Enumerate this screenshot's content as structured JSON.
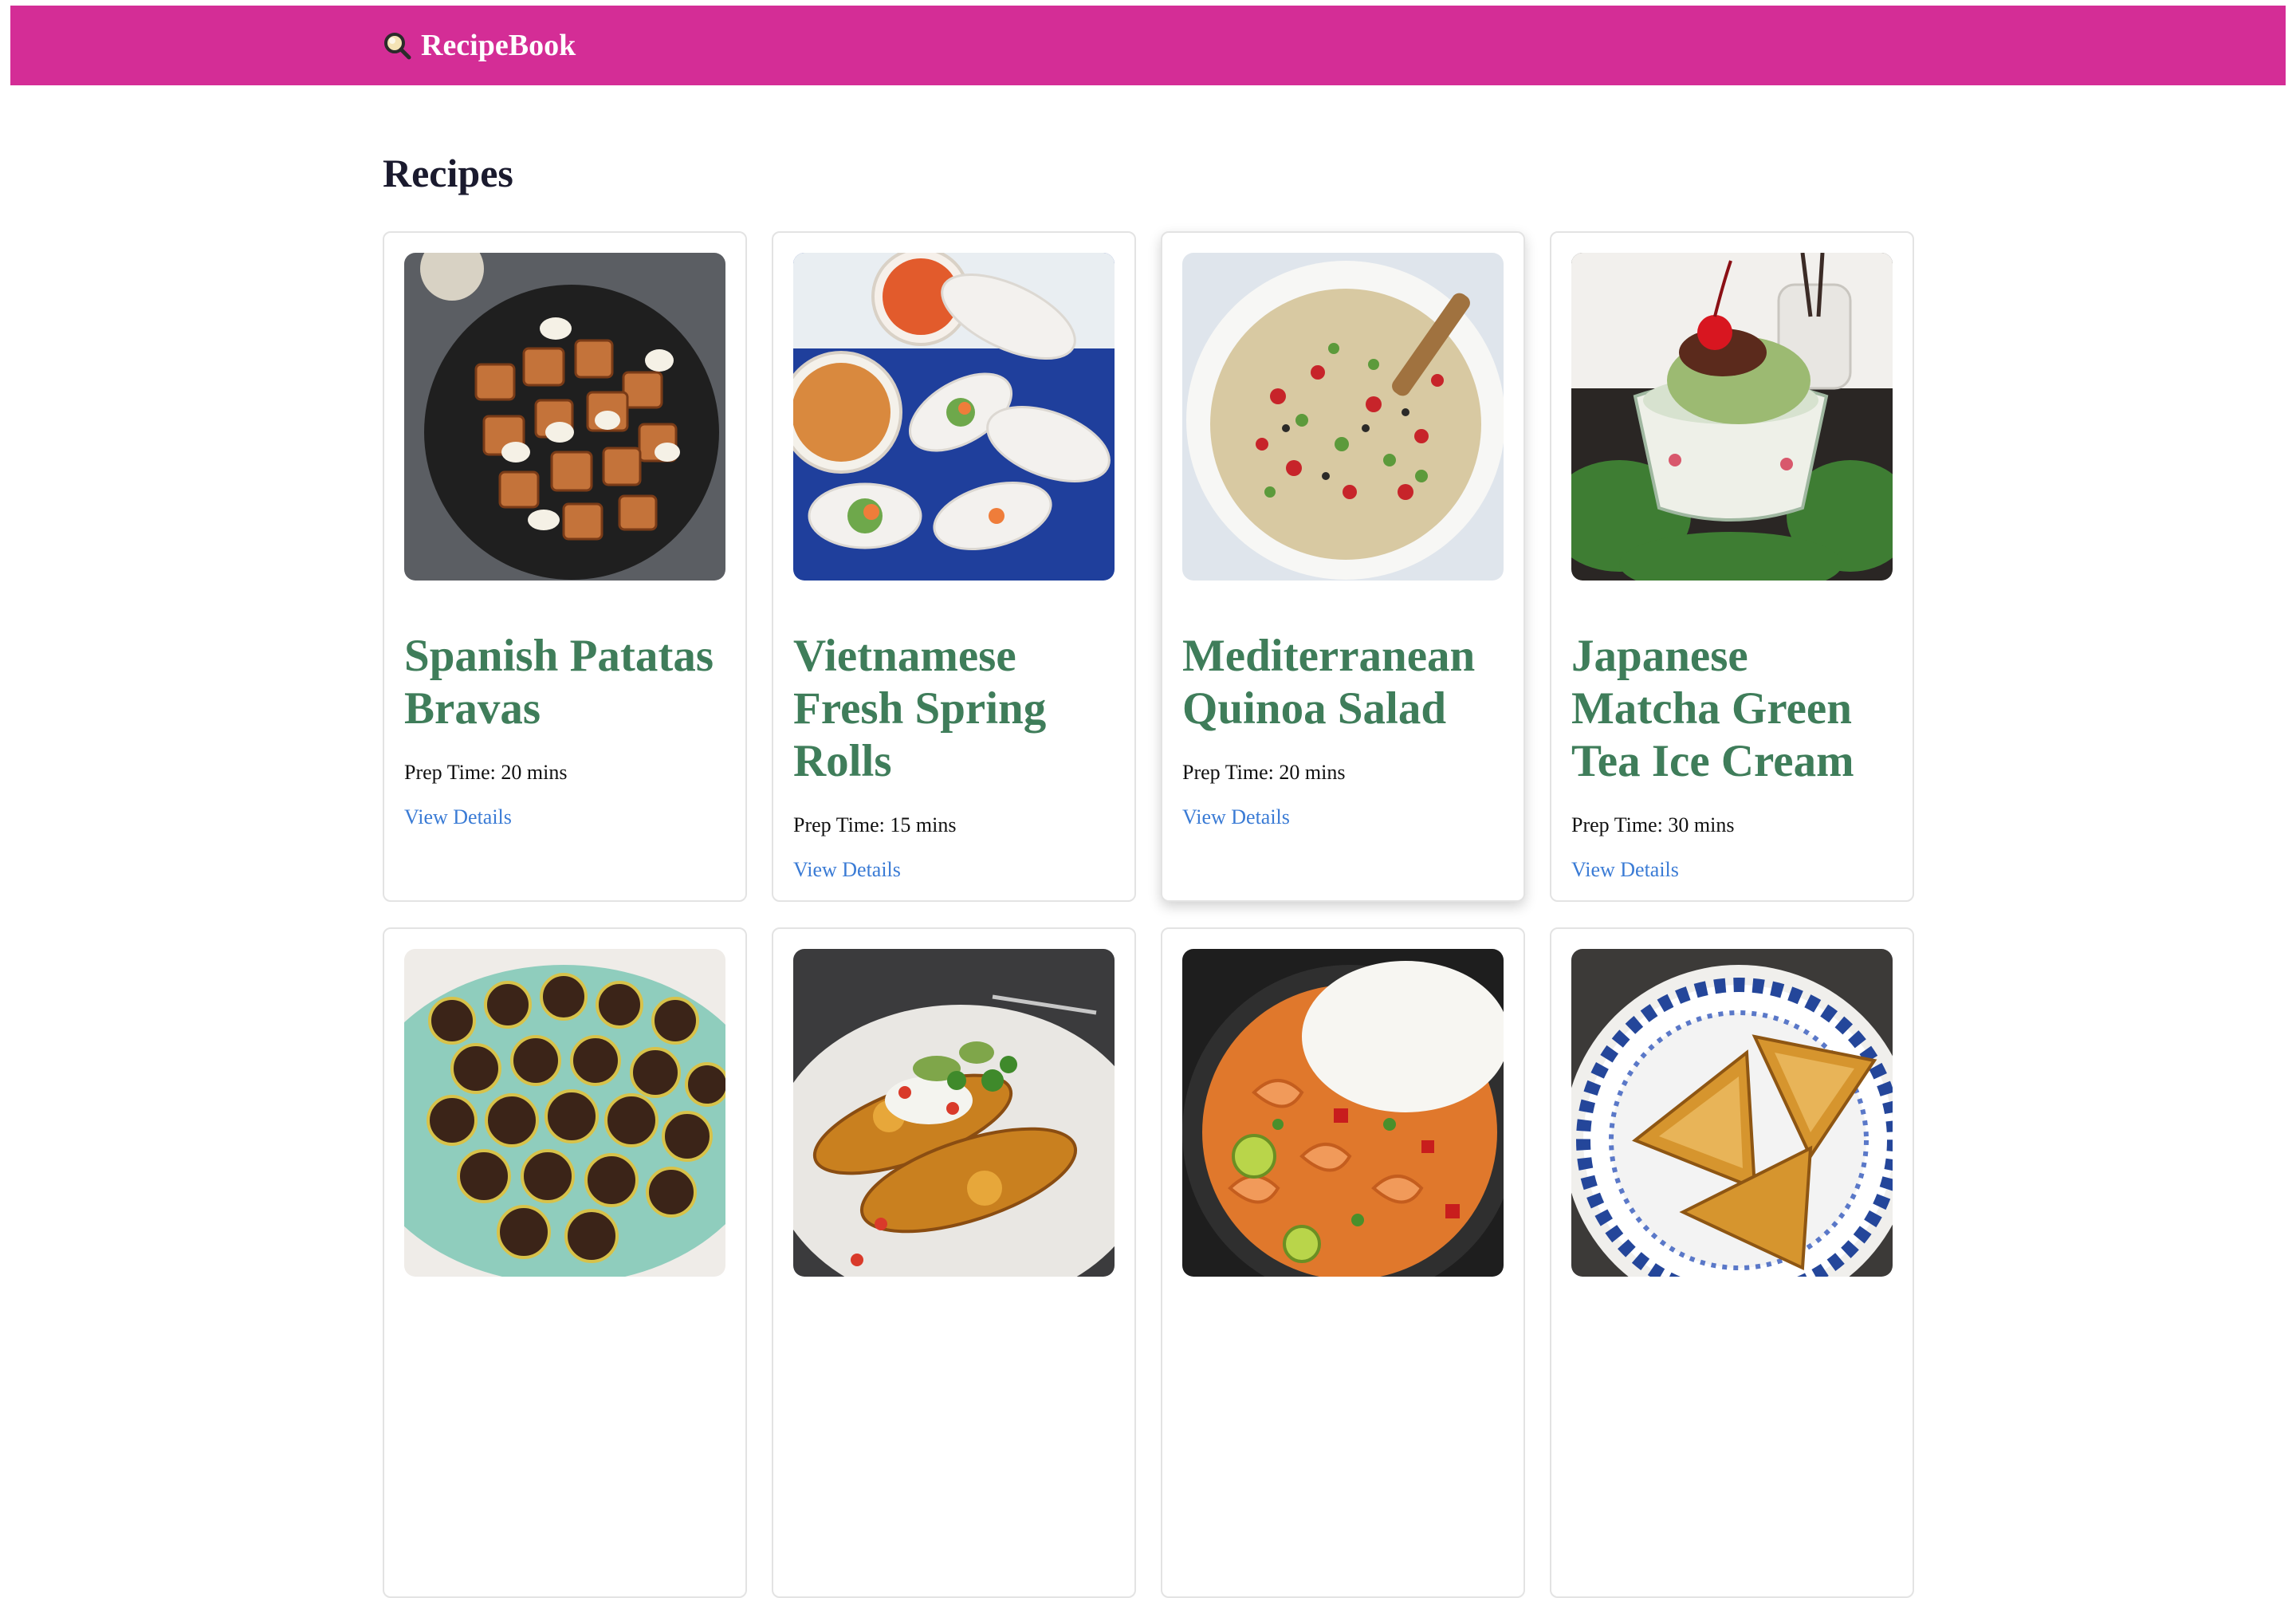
{
  "header": {
    "brand_icon": "magnifier-icon",
    "brand_name": "RecipeBook",
    "background_color": "#d42d96"
  },
  "main": {
    "title": "Recipes"
  },
  "recipes": [
    {
      "title": "Spanish Patatas Bravas",
      "prep_label": "Prep Time:",
      "prep_time": "20 mins",
      "link": "View Details",
      "image": "patatas-bravas-photo"
    },
    {
      "title": "Vietnamese Fresh Spring Rolls",
      "prep_label": "Prep Time:",
      "prep_time": "15 mins",
      "link": "View Details",
      "image": "spring-rolls-photo"
    },
    {
      "title": "Mediterranean Quinoa Salad",
      "prep_label": "Prep Time:",
      "prep_time": "20 mins",
      "link": "View Details",
      "image": "quinoa-salad-photo"
    },
    {
      "title": "Japanese Matcha Green Tea Ice Cream",
      "prep_label": "Prep Time:",
      "prep_time": "30 mins",
      "link": "View Details",
      "image": "matcha-ice-cream-photo"
    },
    {
      "image": "brigadeiros-photo"
    },
    {
      "image": "enchiladas-photo"
    },
    {
      "image": "shrimp-curry-photo"
    },
    {
      "image": "samosas-photo"
    }
  ],
  "colors": {
    "title_green": "#3f7d5a",
    "link_blue": "#3a7bd5"
  }
}
